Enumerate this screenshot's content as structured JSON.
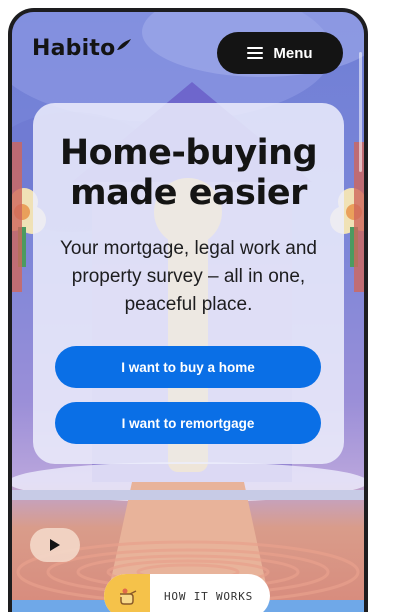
{
  "brand": {
    "name": "Habito"
  },
  "header": {
    "menu_label": "Menu",
    "menu_icon": "hamburger-icon"
  },
  "hero": {
    "headline_line1": "Home-buying",
    "headline_line2": "made easier",
    "subheadline": "Your mortgage, legal work and property survey – all in one, peaceful place."
  },
  "actions": {
    "buy_label": "I want to buy a home",
    "remortgage_label": "I want to remortgage"
  },
  "media": {
    "play_icon": "play-icon"
  },
  "how_it_works": {
    "label": "HOW IT WORKS",
    "icon": "pointing-hand-icon"
  },
  "colors": {
    "primary_blue": "#0a6fe6",
    "dark": "#141414",
    "card": "#eceefc",
    "accent_yellow": "#f5c24a"
  }
}
